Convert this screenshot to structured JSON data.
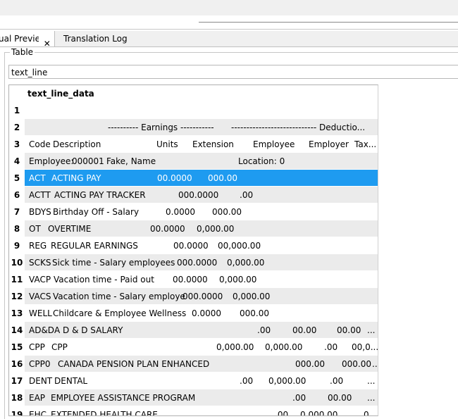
{
  "tabs": [
    {
      "label": "ual Preview"
    },
    {
      "label": "Translation Log"
    }
  ],
  "close_glyph": "✕",
  "group_label": "Table",
  "table_field": "text_line",
  "grid_header": "text_line_data",
  "rows": [
    {
      "num": "1",
      "cells": []
    },
    {
      "num": "2",
      "cells": [
        "---------- Earnings -----------",
        "---------------------------- Deductio..."
      ]
    },
    {
      "num": "3",
      "cells": [
        "Code",
        "Description",
        "Units",
        "Extension",
        "Employee",
        "Employer",
        "Tax..."
      ]
    },
    {
      "num": "4",
      "cells": [
        "Employee:",
        "000001",
        "Fake, Name",
        "Location: 0"
      ]
    },
    {
      "num": "5",
      "cells": [
        "ACT",
        "ACTING PAY",
        "00.0000",
        "000.00"
      ]
    },
    {
      "num": "6",
      "cells": [
        "ACTT",
        "ACTING PAY TRACKER",
        "000.0000",
        ".00"
      ]
    },
    {
      "num": "7",
      "cells": [
        "BDYS",
        "Birthday Off - Salary",
        "0.0000",
        "000.00"
      ]
    },
    {
      "num": "8",
      "cells": [
        "OT",
        "OVERTIME",
        "00.0000",
        "0,000.00"
      ]
    },
    {
      "num": "9",
      "cells": [
        "REG",
        "REGULAR EARNINGS",
        "00.0000",
        "00,000.00"
      ]
    },
    {
      "num": "10",
      "cells": [
        "SCKS",
        "Sick time - Salary employees",
        "000.0000",
        "0,000.00"
      ]
    },
    {
      "num": "11",
      "cells": [
        "VACP",
        "Vacation time - Paid out",
        "00.0000",
        "0,000.00"
      ]
    },
    {
      "num": "12",
      "cells": [
        "VACS",
        "Vacation time - Salary employe",
        "000.0000",
        "0,000.00"
      ]
    },
    {
      "num": "13",
      "cells": [
        "WELL",
        "Childcare & Employee Wellness",
        "0.0000",
        "000.00"
      ]
    },
    {
      "num": "14",
      "cells": [
        "AD&D",
        "A D & D SALARY",
        ".00",
        "00.00",
        "00.00",
        "..."
      ]
    },
    {
      "num": "15",
      "cells": [
        "CPP",
        "CPP",
        "0,000.00",
        "0,000.00",
        ".00",
        "00,0..."
      ]
    },
    {
      "num": "16",
      "cells": [
        "CPP0",
        "CANADA PENSION PLAN ENHANCED",
        "000.00",
        "000.00",
        "..."
      ]
    },
    {
      "num": "17",
      "cells": [
        "DENT",
        "DENTAL",
        ".00",
        "0,000.00",
        ".00",
        "..."
      ]
    },
    {
      "num": "18",
      "cells": [
        "EAP",
        "EMPLOYEE ASSISTANCE PROGRAM",
        ".00",
        "00.00",
        "..."
      ]
    },
    {
      "num": "19",
      "cells": [
        "EHC",
        "EXTENDED HEALTH CARE",
        ".00",
        "0,000.00",
        "0"
      ]
    }
  ],
  "selected_row": "5"
}
